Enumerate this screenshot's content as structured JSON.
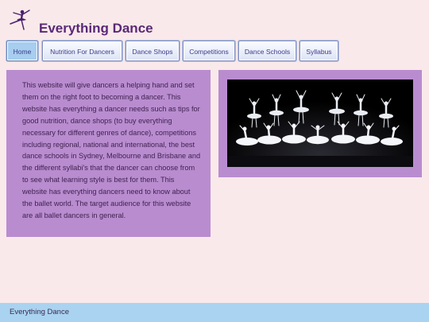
{
  "site": {
    "logo_icon": "ballerina-silhouette-icon",
    "title": "Everything Dance"
  },
  "nav": {
    "items": [
      {
        "label": "Home",
        "active": true
      },
      {
        "label": "Nutrition For Dancers",
        "active": false
      },
      {
        "label": "Dance Shops",
        "active": false
      },
      {
        "label": "Competitions",
        "active": false
      },
      {
        "label": "Dance Schools",
        "active": false
      },
      {
        "label": "Syllabus",
        "active": false
      }
    ]
  },
  "main": {
    "intro": "This website will give dancers a helping hand and set them on the right foot to becoming a dancer. This website has everything a dancer needs such as tips for good nutrition, dance shops (to buy everything necessary for different genres of dance), competitions including regional, national and international, the best dance schools in Sydney, Melbourne and Brisbane and the different syllabi's that the dancer can choose from to see what learning style is best for them. This website has everything dancers need to know about the ballet world. The target audience for this website are all ballet dancers in general.",
    "photo_subject": "ballet-corps-performance-photo"
  },
  "footer": {
    "text": "Everything Dance"
  },
  "colors": {
    "page_background": "#f9e9ea",
    "title": "#5a2878",
    "panel_background": "#b98cd0",
    "footer_background": "#a9d3f1",
    "nav_active": "#a7cdef"
  }
}
